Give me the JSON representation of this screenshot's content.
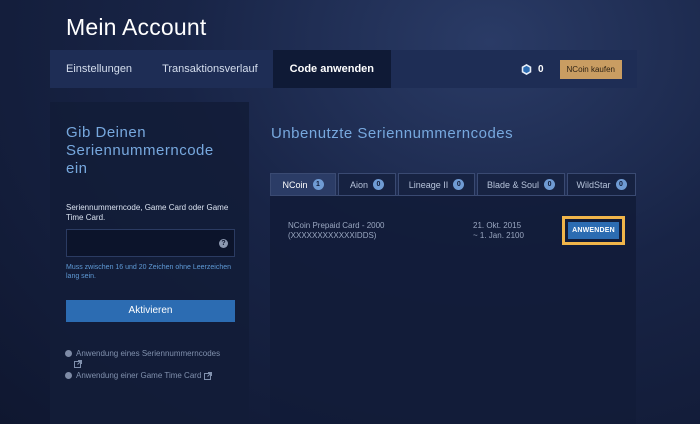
{
  "page_title": "Mein Account",
  "nav": {
    "tabs": [
      {
        "label": "Einstellungen"
      },
      {
        "label": "Transaktionsverlauf"
      },
      {
        "label": "Code anwenden"
      }
    ],
    "coin_icon": "ncoin-icon",
    "coin_count": "0",
    "buy_label": "NCoin kaufen",
    "colors": {
      "accent": "#2c6cb2",
      "buy": "#c99d62",
      "highlight": "#f0b54a"
    }
  },
  "left": {
    "title": "Gib Deinen Seriennummerncode ein",
    "field_label": "Seriennummerncode, Game Card oder Game Time Card.",
    "input_value": "",
    "help_icon": "help-icon",
    "hint": "Muss zwischen 16 und 20 Zeichen ohne Leerzeichen lang sein.",
    "activate_label": "Aktivieren",
    "links": [
      {
        "label": "Anwendung eines Seriennummerncodes"
      },
      {
        "label": "Anwendung einer Game Time Card"
      }
    ]
  },
  "right": {
    "title": "Unbenutzte Seriennummerncodes",
    "tabs": [
      {
        "label": "NCoin",
        "count": "1"
      },
      {
        "label": "Aion",
        "count": "0"
      },
      {
        "label": "Lineage II",
        "count": "0"
      },
      {
        "label": "Blade & Soul",
        "count": "0"
      },
      {
        "label": "WildStar",
        "count": "0"
      }
    ],
    "card": {
      "name": "NCoin Prepaid Card - 2000",
      "code": "(XXXXXXXXXXXXIDDS)",
      "date_from": "21. Okt. 2015",
      "date_to": "~ 1. Jan. 2100",
      "apply_label": "ANWENDEN"
    }
  }
}
